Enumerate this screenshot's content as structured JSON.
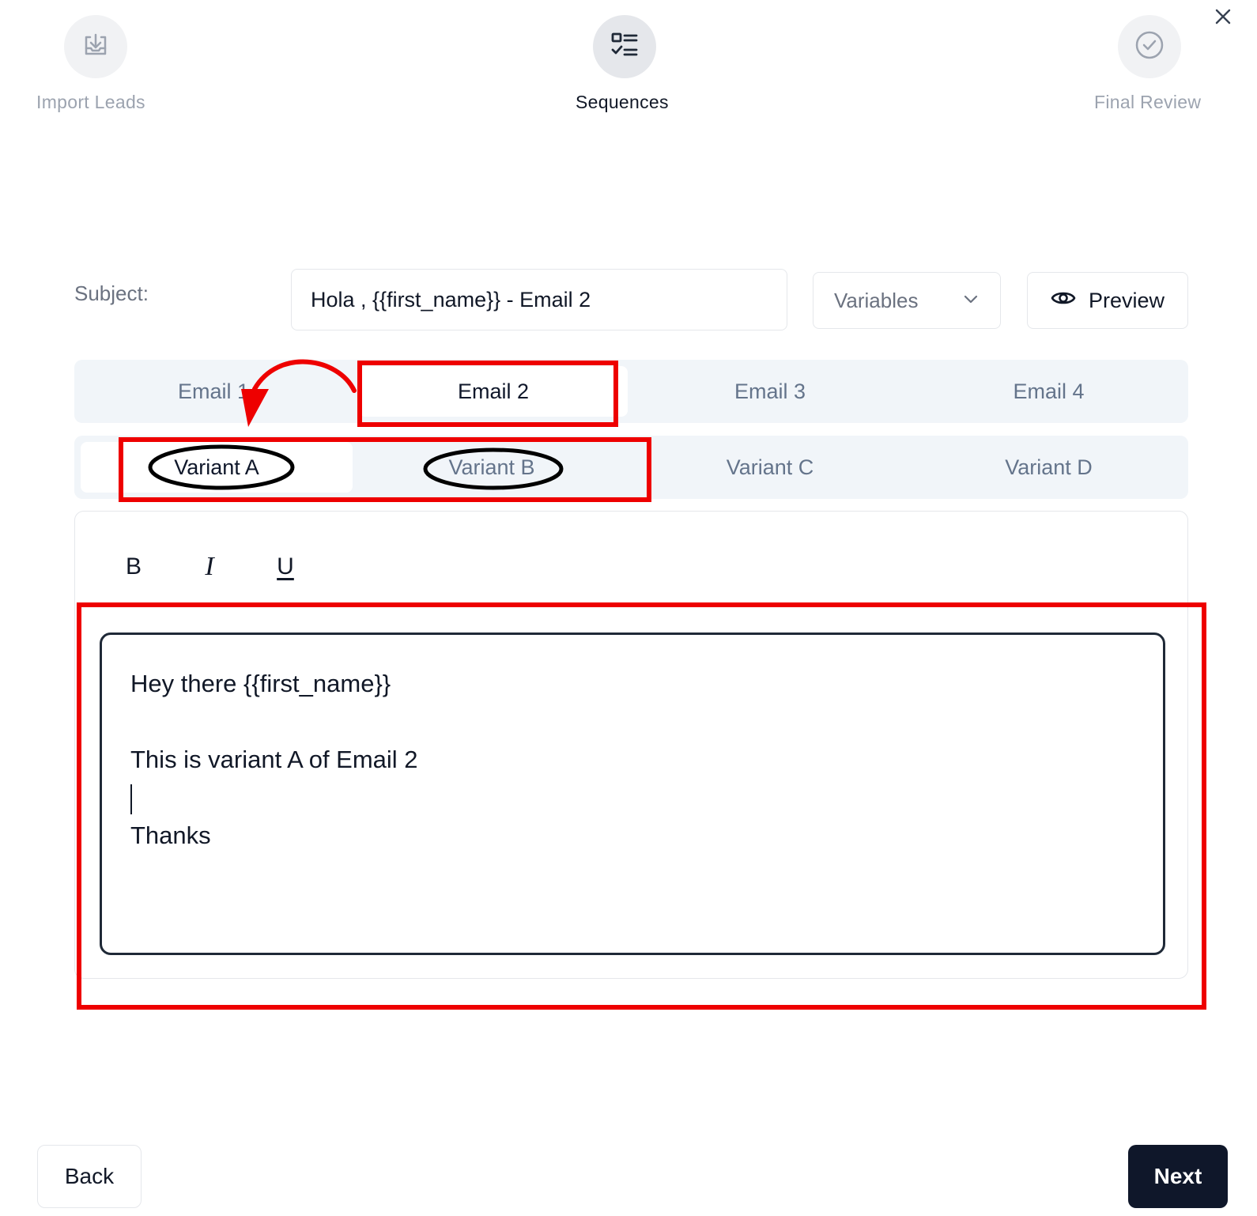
{
  "stepper": {
    "steps": [
      {
        "label": "Import Leads",
        "icon": "import-icon",
        "state": "completed"
      },
      {
        "label": "Sequences",
        "icon": "checklist-icon",
        "state": "active"
      },
      {
        "label": "Final Review",
        "icon": "check-circle-icon",
        "state": "upcoming"
      }
    ]
  },
  "subject": {
    "label": "Subject:",
    "value": "Hola , {{first_name}} - Email 2"
  },
  "variables_dropdown": {
    "label": "Variables"
  },
  "preview_button": {
    "label": "Preview"
  },
  "email_tabs": {
    "items": [
      "Email 1",
      "Email 2",
      "Email 3",
      "Email 4"
    ],
    "selected": "Email 2"
  },
  "variant_tabs": {
    "items": [
      "Variant A",
      "Variant B",
      "Variant C",
      "Variant D"
    ],
    "selected": "Variant A"
  },
  "toolbar": {
    "bold": "B",
    "italic": "I",
    "underline": "U"
  },
  "editor": {
    "lines": [
      "Hey there {{first_name}}",
      "",
      "This is variant A of Email 2",
      "",
      "Thanks"
    ]
  },
  "footer": {
    "back_label": "Back",
    "next_label": "Next"
  },
  "colors": {
    "annotation_red": "#ee0000",
    "primary_dark": "#0f172a"
  }
}
